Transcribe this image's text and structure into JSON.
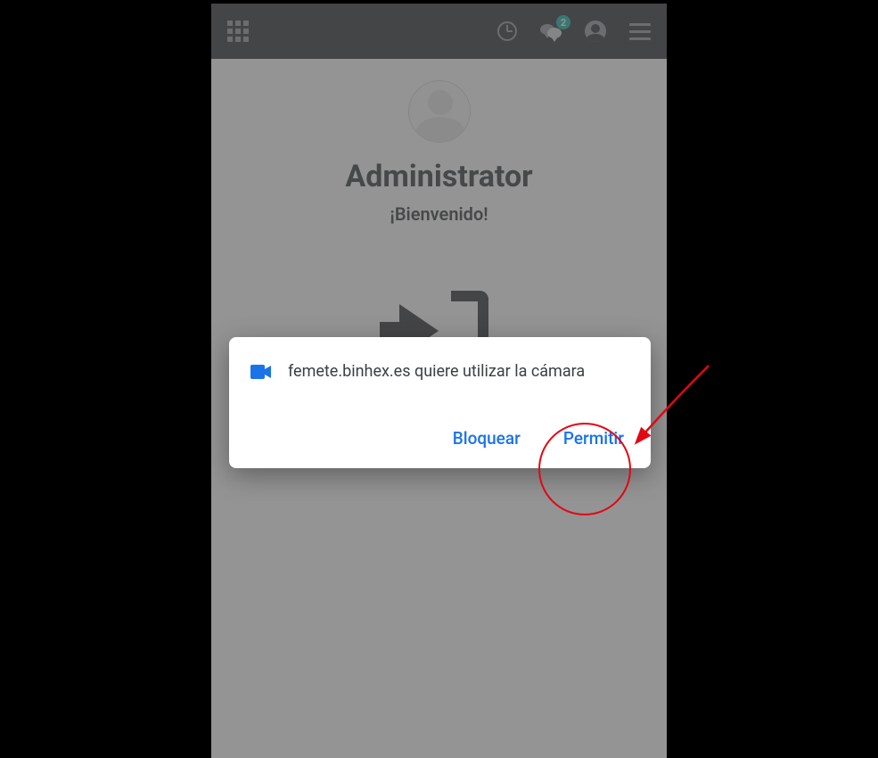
{
  "header": {
    "notifications_count": "2"
  },
  "content": {
    "user_name": "Administrator",
    "welcome_text": "¡Bienvenido!"
  },
  "dialog": {
    "message": "femete.binhex.es quiere utilizar la cámara",
    "block_label": "Bloquear",
    "allow_label": "Permitir"
  },
  "icons": {
    "apps": "apps-grid-icon",
    "clock": "clock-icon",
    "chat": "chat-icon",
    "user": "user-icon",
    "menu": "hamburger-icon",
    "camera": "camera-icon",
    "attendance": "sign-in-icon"
  },
  "colors": {
    "accent": "#1a73e8",
    "badge": "#00a99d",
    "annotation": "#e30613"
  }
}
